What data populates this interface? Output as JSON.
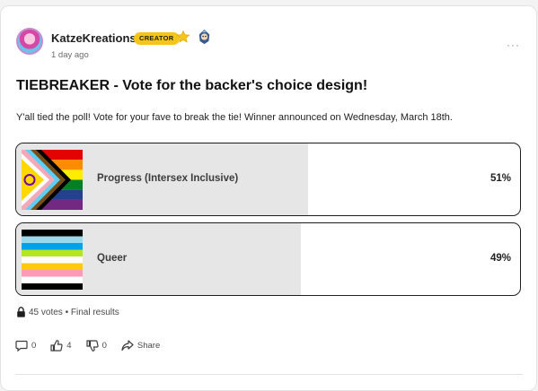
{
  "post": {
    "author": "KatzeKreations",
    "badge": "CREATOR",
    "timestamp": "1 day ago",
    "more": "···",
    "title": "TIEBREAKER - Vote for the backer's choice design!",
    "body": "Y'all tied the poll! Vote for your fave to break the tie! Winner announced on Wednesday, March 18th."
  },
  "poll": {
    "options": [
      {
        "label": "Progress (Intersex Inclusive)",
        "percent": "51%",
        "fraction": 0.51
      },
      {
        "label": "Queer",
        "percent": "49%",
        "fraction": 0.49
      }
    ],
    "meta": "45 votes • Final results"
  },
  "actions": {
    "comments": "0",
    "likes": "4",
    "dislikes": "0",
    "share": "Share"
  },
  "colors": {
    "accent_badge": "#f5c518",
    "result_fill": "#e6e6e6",
    "border": "#1e1e1e"
  }
}
